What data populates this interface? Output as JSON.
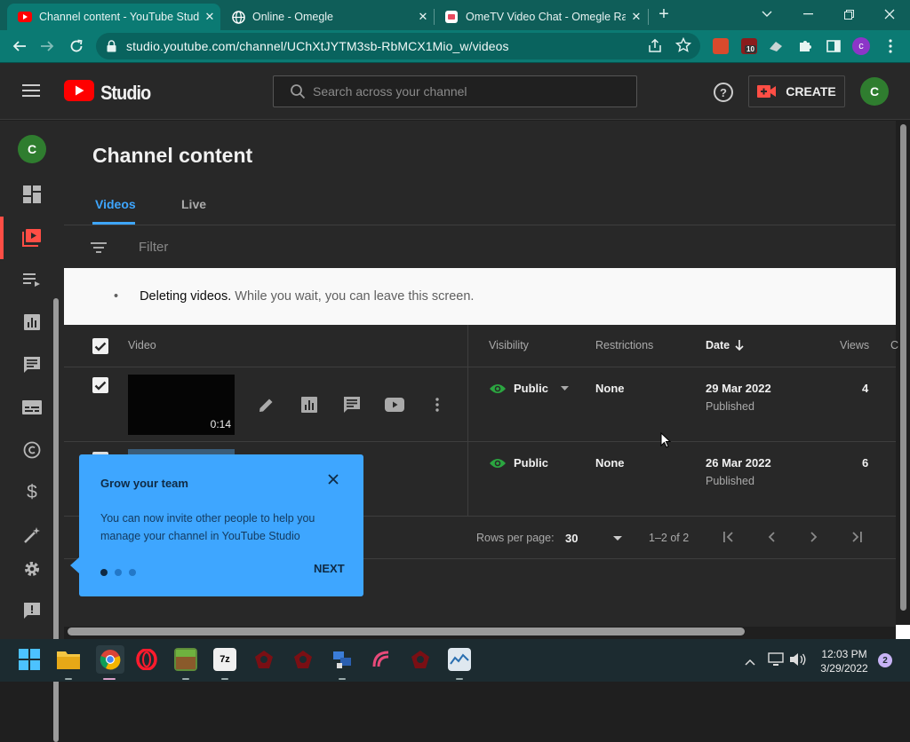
{
  "browser": {
    "tabs": [
      {
        "title": "Channel content - YouTube Studio",
        "active": true
      },
      {
        "title": "Online - Omegle",
        "active": false
      },
      {
        "title": "OmeTV Video Chat - Omegle Random",
        "active": false
      }
    ],
    "new_tab": "+",
    "url": "studio.youtube.com/channel/UChXtJYTM3sb-RbMCX1Mio_w/videos",
    "ext_badge": "10",
    "profile_initial": "c"
  },
  "studio": {
    "logo_text": "Studio",
    "search_placeholder": "Search across your channel",
    "help_icon": "?",
    "create_label": "CREATE",
    "avatar_initial": "C"
  },
  "sidebar": {
    "avatar_initial": "C",
    "items": [
      "dashboard",
      "content",
      "playlists",
      "analytics",
      "comments",
      "subtitles",
      "copyright",
      "monetization",
      "customization",
      "settings",
      "feedback"
    ]
  },
  "page": {
    "title": "Channel content",
    "tabs": [
      "Videos",
      "Live"
    ],
    "filter_placeholder": "Filter",
    "notice_bullet": "•",
    "notice_bold": "Deleting videos.",
    "notice_rest": " While you wait, you can leave this screen."
  },
  "table": {
    "headers": {
      "video": "Video",
      "visibility": "Visibility",
      "restrictions": "Restrictions",
      "date": "Date",
      "views": "Views",
      "comments_trunc": "C"
    },
    "rows": [
      {
        "duration": "0:14",
        "visibility": "Public",
        "restrictions": "None",
        "date": "29 Mar 2022",
        "status": "Published",
        "views": "4",
        "checked": true
      },
      {
        "duration": "",
        "visibility": "Public",
        "restrictions": "None",
        "date": "26 Mar 2022",
        "status": "Published",
        "views": "6",
        "checked": false
      }
    ],
    "pager": {
      "rows_per_page_label": "Rows per page:",
      "rows_per_page_value": "30",
      "range": "1–2 of 2"
    }
  },
  "tooltip": {
    "title": "Grow your team",
    "body": "You can now invite other people to help you manage your channel in YouTube Studio",
    "next": "NEXT",
    "step": 1,
    "steps": 3
  },
  "taskbar": {
    "time": "12:03 PM",
    "date": "3/29/2022",
    "notifications": "2",
    "app_7z": "7z"
  },
  "colors": {
    "studio_bg": "#282828",
    "accent_blue": "#3ea6ff",
    "youtube_red": "#ff0000",
    "public_green": "#2ba640",
    "browser_teal": "#0b7a73"
  }
}
